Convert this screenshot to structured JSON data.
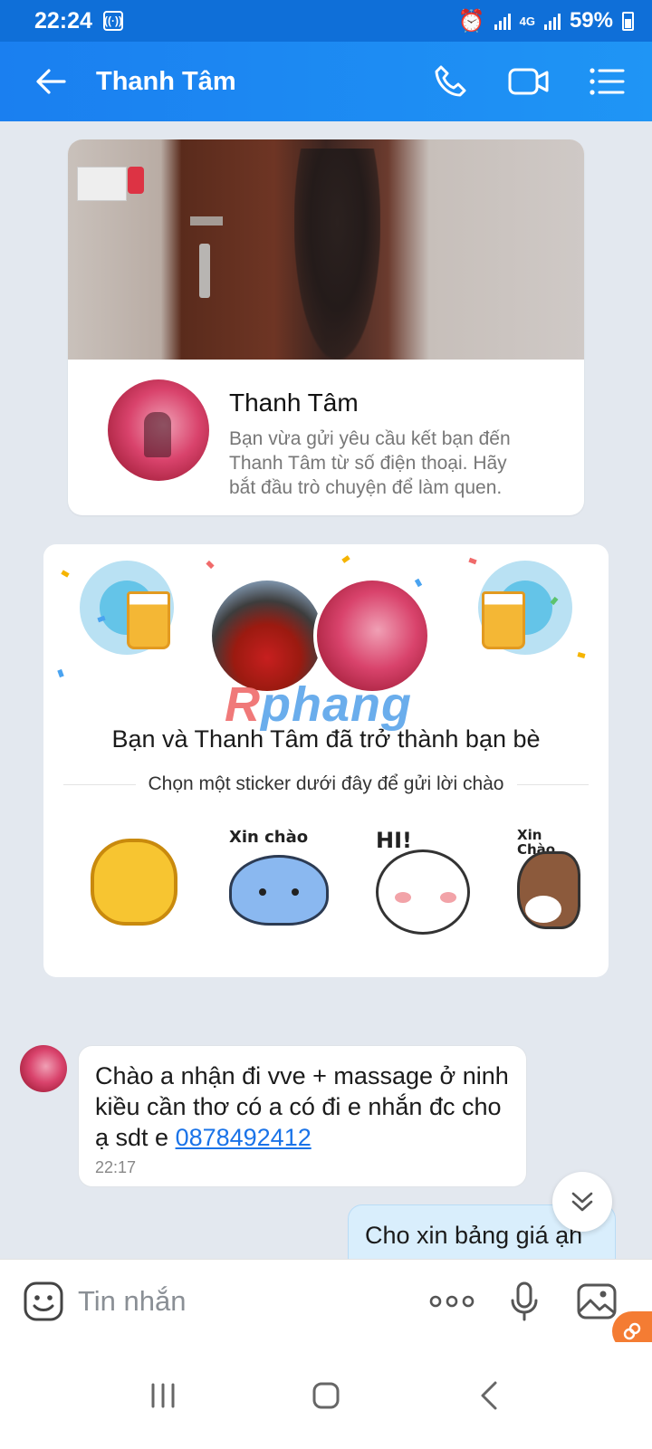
{
  "status_bar": {
    "time": "22:24",
    "network": "4G",
    "battery": "59%"
  },
  "header": {
    "title": "Thanh Tâm",
    "icons": [
      "back-arrow-icon",
      "phone-icon",
      "video-call-icon",
      "menu-list-icon"
    ]
  },
  "profile_card": {
    "name": "Thanh Tâm",
    "description": "Bạn vừa gửi yêu cầu kết bạn đến Thanh Tâm từ số điện thoại. Hãy bắt đầu trò chuyện để làm quen."
  },
  "friend_card": {
    "watermark": "Rphang",
    "title": "Bạn và Thanh Tâm đã trở thành bạn bè",
    "prompt": "Chọn một sticker dưới đây để gửi lời chào",
    "stickers": [
      {
        "name": "waving-hand",
        "caption": ""
      },
      {
        "name": "xin-chao-cat",
        "caption": "Xin chào"
      },
      {
        "name": "hi-bunny",
        "caption": "HI!"
      },
      {
        "name": "xin-chao-dog",
        "caption": "Xin Chào"
      }
    ]
  },
  "messages": [
    {
      "direction": "in",
      "text": "Chào a nhận đi vve + massage ở ninh kiều cần thơ có a có đi e nhắn đc cho ạ sdt e ",
      "phone": "0878492412",
      "time": "22:17"
    },
    {
      "direction": "out",
      "text": "Cho xin bảng giá ạh"
    }
  ],
  "input_bar": {
    "placeholder": "Tin nhắn"
  },
  "colors": {
    "header": "#1a7ff0",
    "status_bar": "#0f6fd8",
    "chat_bg": "#e3e8ef",
    "link": "#1a73e8",
    "outgoing_bubble": "#d9eefc"
  }
}
